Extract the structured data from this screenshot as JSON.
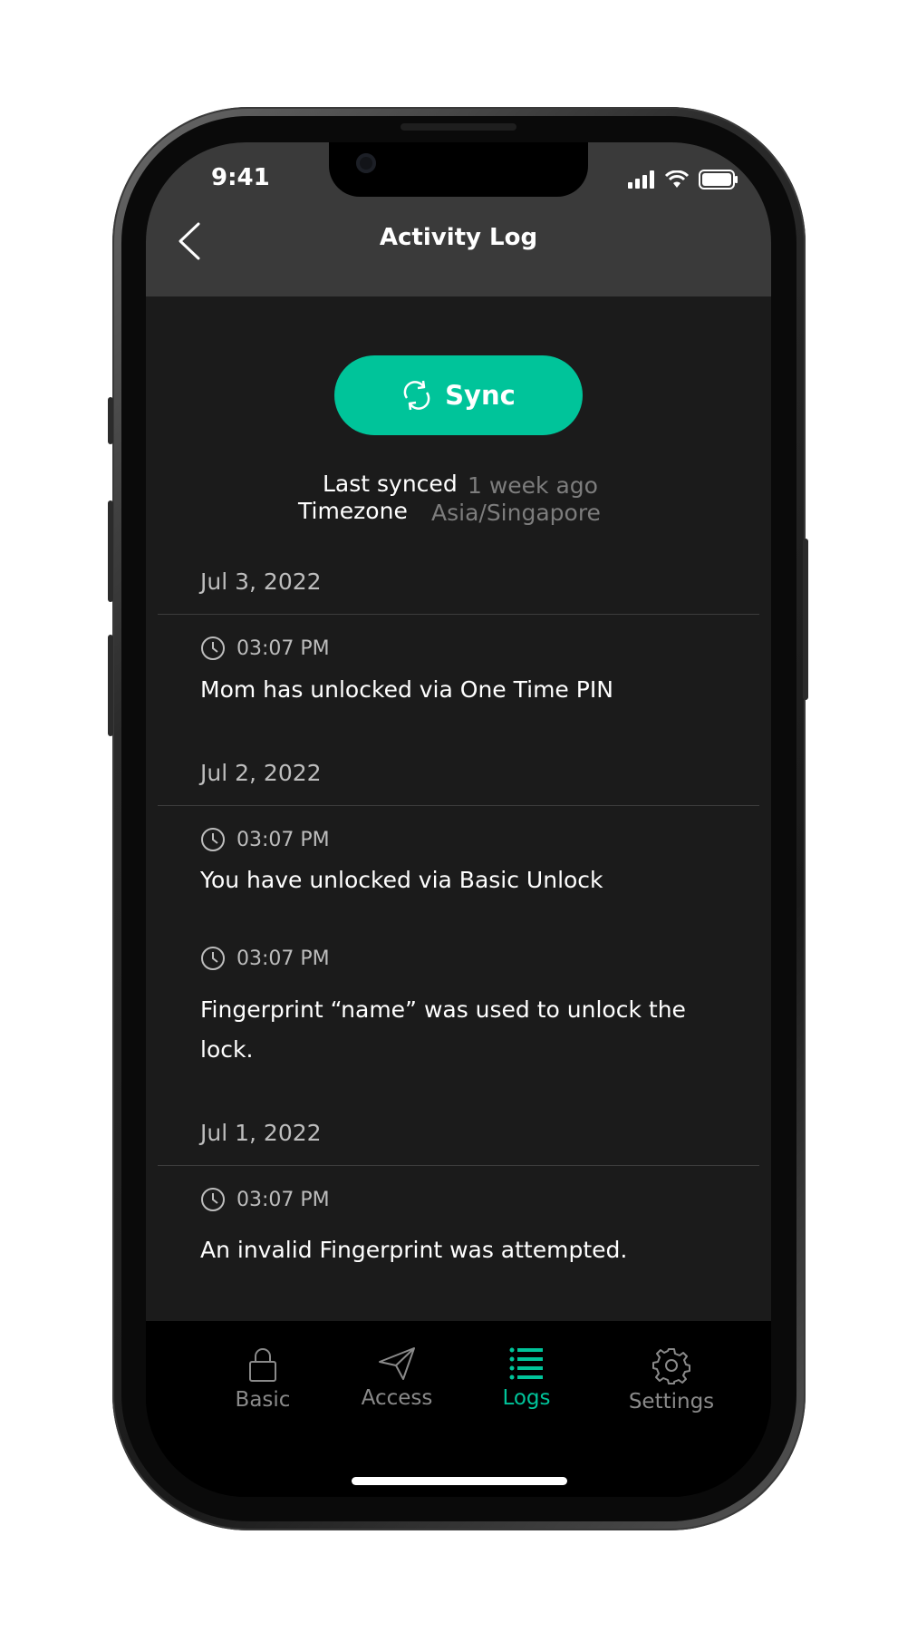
{
  "status_bar": {
    "time": "9:41"
  },
  "header": {
    "title": "Activity Log",
    "back_icon": "chevron-left-icon"
  },
  "sync": {
    "label": "Sync",
    "icon": "sync-icon",
    "color": "#00c49a"
  },
  "meta": {
    "last_synced_label": "Last synced",
    "last_synced_value": "1 week ago",
    "timezone_label": "Timezone",
    "timezone_value": "Asia/Singapore"
  },
  "groups": [
    {
      "date": "Jul 3, 2022",
      "entries": [
        {
          "time": "03:07 PM",
          "text": "Mom has unlocked via One Time PIN"
        }
      ]
    },
    {
      "date": "Jul 2, 2022",
      "entries": [
        {
          "time": "03:07 PM",
          "text": "You have unlocked via Basic Unlock"
        },
        {
          "time": "03:07 PM",
          "text": "Fingerprint “name” was used to unlock the lock."
        }
      ]
    },
    {
      "date": "Jul 1, 2022",
      "entries": [
        {
          "time": "03:07 PM",
          "text": "An invalid Fingerprint was attempted."
        }
      ]
    }
  ],
  "tabs": [
    {
      "label": "Basic",
      "icon": "lock-icon",
      "active": false
    },
    {
      "label": "Access",
      "icon": "send-icon",
      "active": false
    },
    {
      "label": "Logs",
      "icon": "list-icon",
      "active": true
    },
    {
      "label": "Settings",
      "icon": "gear-icon",
      "active": false
    }
  ],
  "colors": {
    "accent": "#00c49a",
    "header_bg": "#3a3a3a",
    "content_bg": "#1b1b1b"
  }
}
